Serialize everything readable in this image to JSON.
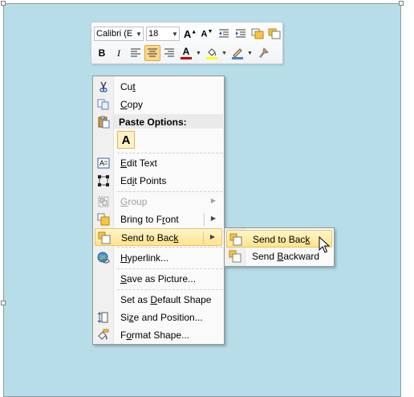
{
  "colors": {
    "shape_fill": "#b7dde8",
    "highlight": "#ffe48a",
    "highlight_border": "#e5c365",
    "disabled_text": "#a0a0a0",
    "font_color_bar": "#c00000",
    "fill_color_bar": "#ffff00",
    "line_color_bar": "#4f81bd"
  },
  "mini_toolbar": {
    "font_name": "Calibri (E",
    "font_size": "18",
    "buttons_row1": [
      {
        "name": "grow-font-button",
        "icon": "grow-font-icon",
        "glyph": "A˄"
      },
      {
        "name": "shrink-font-button",
        "icon": "shrink-font-icon",
        "glyph": "A˅"
      },
      {
        "name": "decrease-indent-button",
        "icon": "decrease-indent-icon"
      },
      {
        "name": "increase-indent-button",
        "icon": "increase-indent-icon"
      },
      {
        "name": "bring-forward-button",
        "icon": "bring-forward-icon"
      },
      {
        "name": "send-backward-button",
        "icon": "send-backward-icon"
      }
    ],
    "bold_glyph": "B",
    "italic_glyph": "I",
    "font_color_glyph": "A"
  },
  "context_menu": {
    "cut": {
      "pre": "Cu",
      "acc": "t",
      "post": ""
    },
    "copy": {
      "pre": "",
      "acc": "C",
      "post": "opy"
    },
    "paste_options": "Paste Options:",
    "paste_keep_text": "A",
    "edit_text": {
      "pre": "",
      "acc": "E",
      "post": "dit Text"
    },
    "edit_points": {
      "pre": "Ed",
      "acc": "i",
      "post": "t Points"
    },
    "group": {
      "pre": "",
      "acc": "G",
      "post": "roup"
    },
    "bring_to_front": {
      "pre": "Bring to F",
      "acc": "r",
      "post": "ont"
    },
    "send_to_back": {
      "pre": "Send to Bac",
      "acc": "k",
      "post": ""
    },
    "hyperlink": {
      "pre": "",
      "acc": "H",
      "post": "yperlink..."
    },
    "save_as_picture": {
      "pre": "",
      "acc": "S",
      "post": "ave as Picture..."
    },
    "set_default": {
      "pre": "Set as ",
      "acc": "D",
      "post": "efault Shape"
    },
    "size_position": {
      "pre": "Si",
      "acc": "z",
      "post": "e and Position..."
    },
    "format_shape": {
      "pre": "F",
      "acc": "o",
      "post": "rmat Shape..."
    }
  },
  "submenu": {
    "send_to_back": {
      "pre": "Send to Bac",
      "acc": "k",
      "post": ""
    },
    "send_backward": {
      "pre": "Send ",
      "acc": "B",
      "post": "ackward"
    }
  }
}
